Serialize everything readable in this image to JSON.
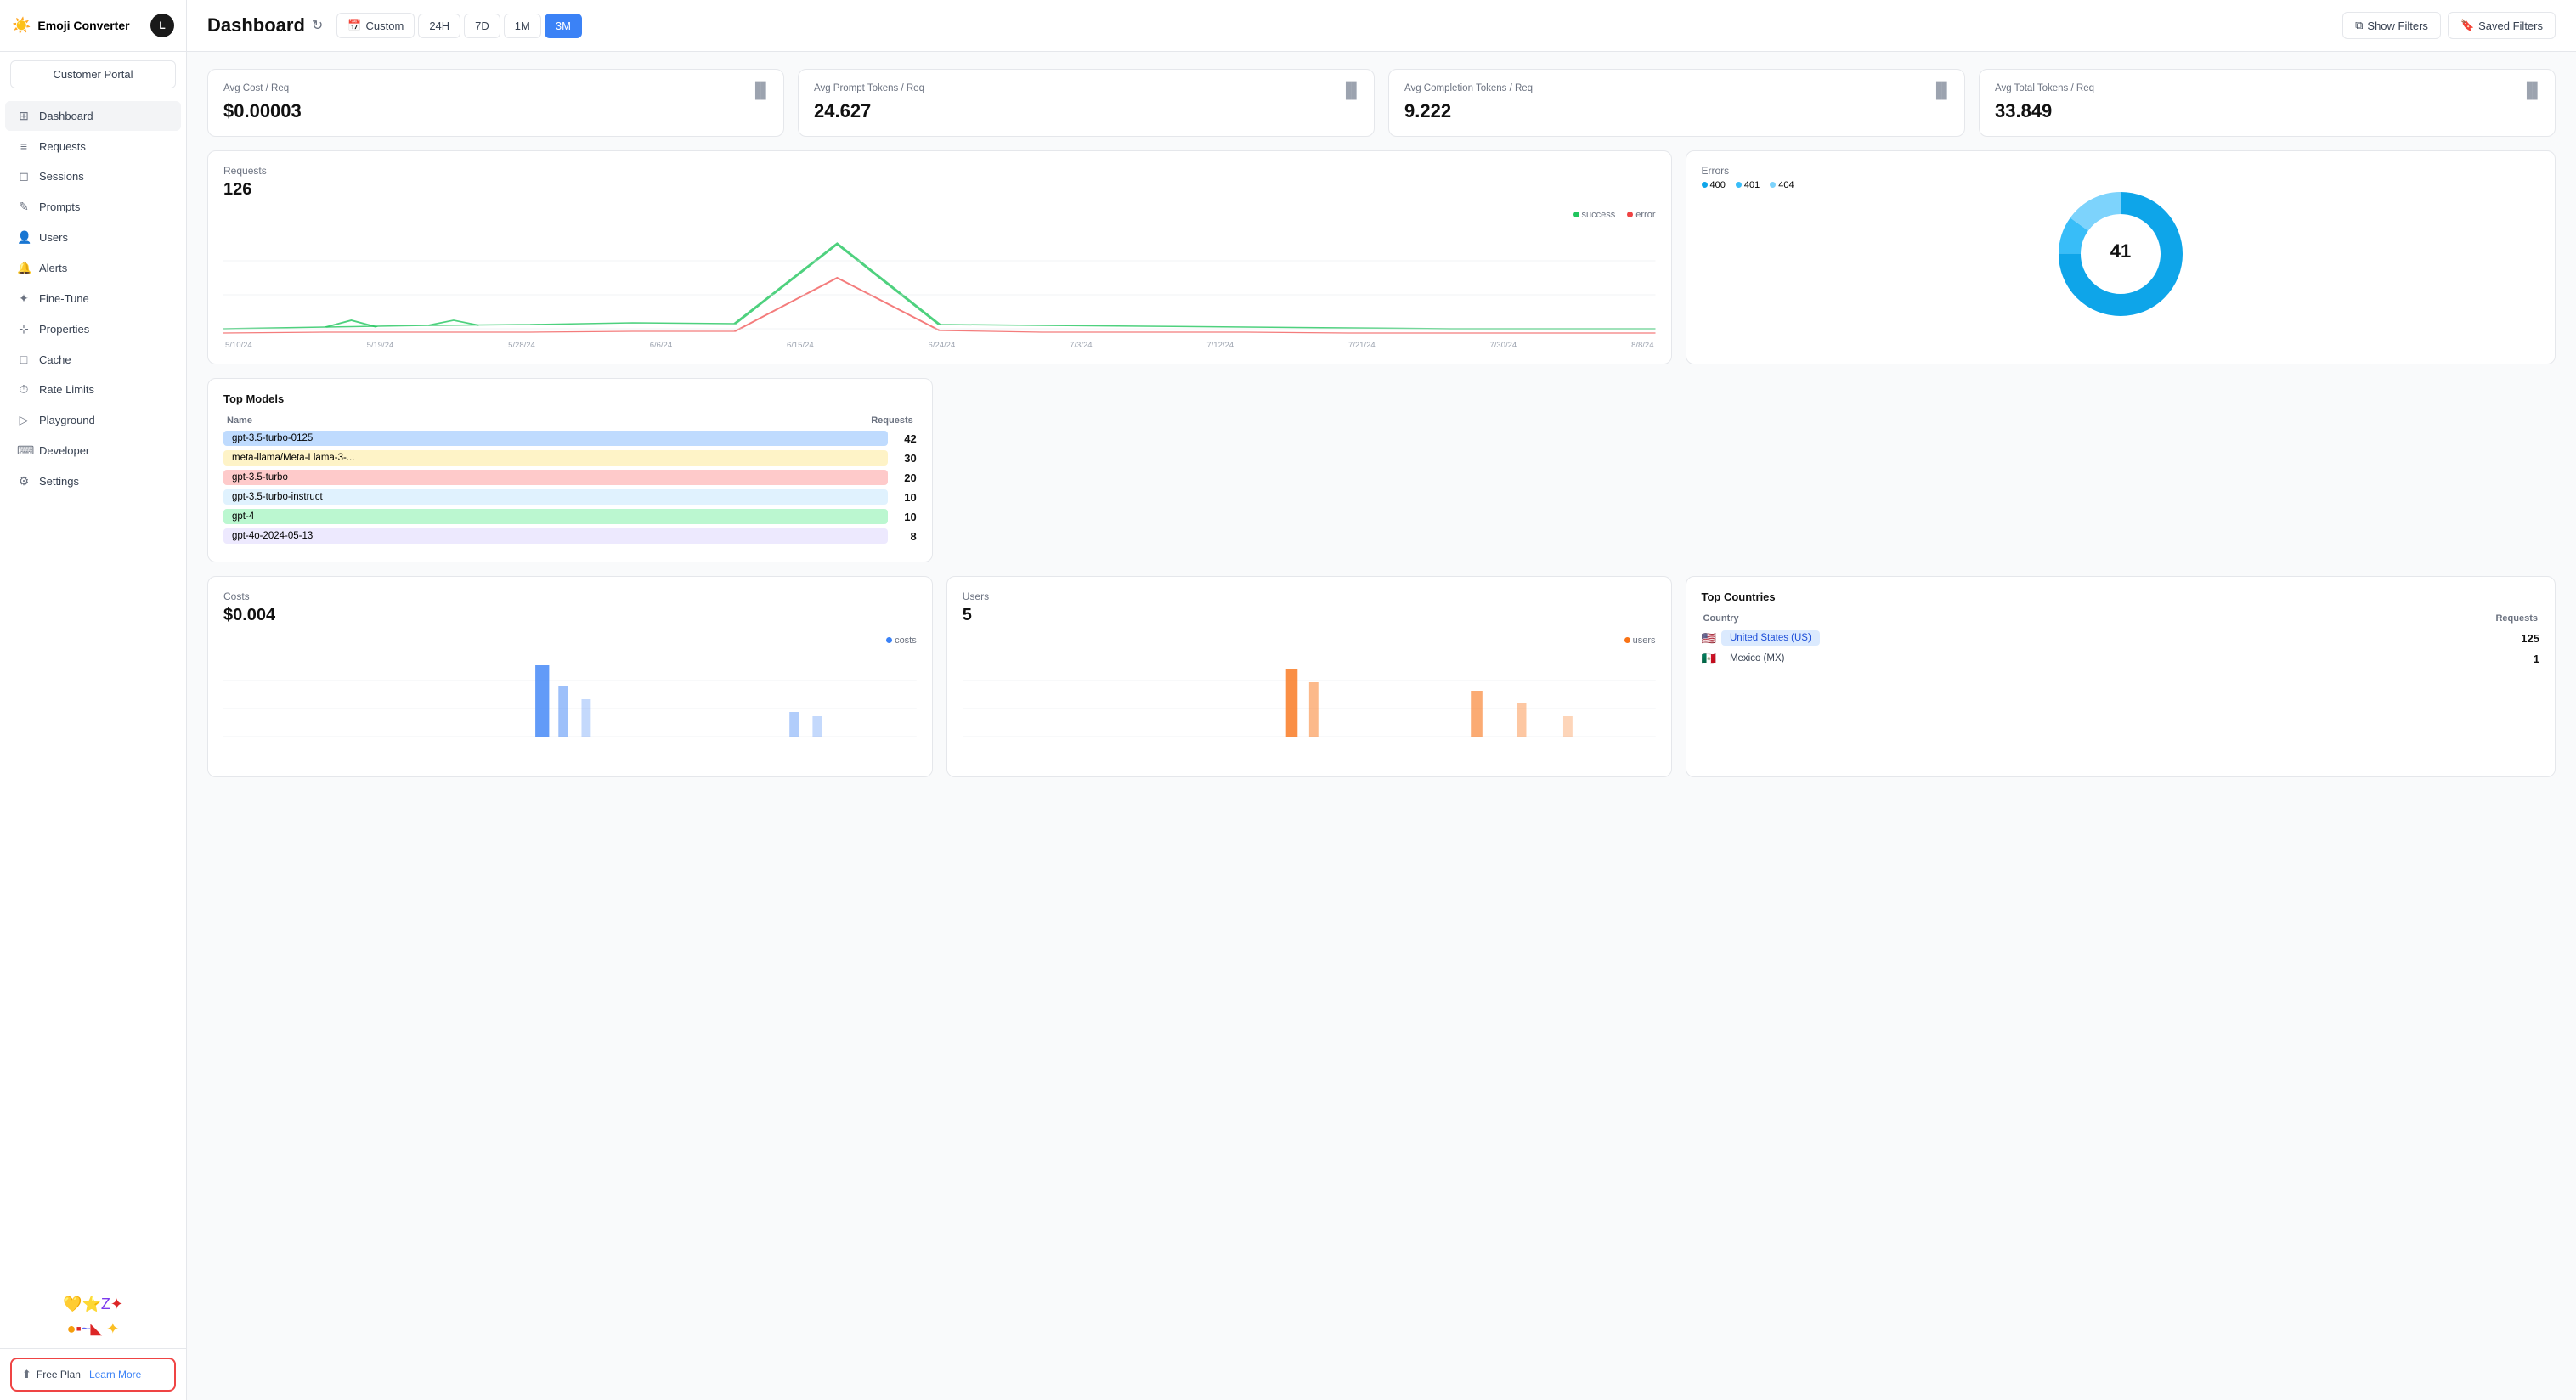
{
  "app": {
    "name": "Emoji Converter",
    "avatar_letter": "L",
    "app_icon": "☀️"
  },
  "sidebar": {
    "customer_portal_label": "Customer Portal",
    "nav_items": [
      {
        "id": "dashboard",
        "label": "Dashboard",
        "icon": "⊞",
        "active": true
      },
      {
        "id": "requests",
        "label": "Requests",
        "icon": "≡"
      },
      {
        "id": "sessions",
        "label": "Sessions",
        "icon": "◻"
      },
      {
        "id": "prompts",
        "label": "Prompts",
        "icon": "✎"
      },
      {
        "id": "users",
        "label": "Users",
        "icon": "👤"
      },
      {
        "id": "alerts",
        "label": "Alerts",
        "icon": "🔔"
      },
      {
        "id": "finetune",
        "label": "Fine-Tune",
        "icon": "✦"
      },
      {
        "id": "properties",
        "label": "Properties",
        "icon": "⊹"
      },
      {
        "id": "cache",
        "label": "Cache",
        "icon": "□"
      },
      {
        "id": "ratelimits",
        "label": "Rate Limits",
        "icon": "⏱"
      },
      {
        "id": "playground",
        "label": "Playground",
        "icon": "▷"
      },
      {
        "id": "developer",
        "label": "Developer",
        "icon": "⌨"
      },
      {
        "id": "settings",
        "label": "Settings",
        "icon": "⚙"
      }
    ],
    "free_plan": "Free Plan",
    "learn_more": "Learn More"
  },
  "header": {
    "title": "Dashboard",
    "time_filters": [
      "Custom",
      "24H",
      "7D",
      "1M",
      "3M"
    ],
    "active_filter": "3M",
    "show_filters": "Show Filters",
    "saved_filters": "Saved Filters"
  },
  "stats": [
    {
      "label": "Avg Cost / Req",
      "value": "$0.00003"
    },
    {
      "label": "Avg Prompt Tokens / Req",
      "value": "24.627"
    },
    {
      "label": "Avg Completion Tokens / Req",
      "value": "9.222"
    },
    {
      "label": "Avg Total Tokens / Req",
      "value": "33.849"
    }
  ],
  "requests_chart": {
    "title": "Requests",
    "value": "126",
    "legend_success": "success",
    "legend_error": "error",
    "x_labels": [
      "5/10/24",
      "5/19/24",
      "5/28/24",
      "6/6/24",
      "6/15/24",
      "6/24/24",
      "7/3/24",
      "7/12/24",
      "7/21/24",
      "7/30/24",
      "8/8/24"
    ]
  },
  "errors_chart": {
    "title": "Errors",
    "center_value": "41",
    "legend": [
      {
        "label": "400",
        "color": "#0ea5e9"
      },
      {
        "label": "401",
        "color": "#38bdf8"
      },
      {
        "label": "404",
        "color": "#7dd3fc"
      }
    ]
  },
  "top_models": {
    "title": "Top Models",
    "col_name": "Name",
    "col_requests": "Requests",
    "rows": [
      {
        "name": "gpt-3.5-turbo-0125",
        "count": 42,
        "color": "#bfdbfe"
      },
      {
        "name": "meta-llama/Meta-Llama-3-...",
        "count": 30,
        "color": "#fef3c7"
      },
      {
        "name": "gpt-3.5-turbo",
        "count": 20,
        "color": "#fecaca"
      },
      {
        "name": "gpt-3.5-turbo-instruct",
        "count": 10,
        "color": "#e0f2fe"
      },
      {
        "name": "gpt-4",
        "count": 10,
        "color": "#bbf7d0"
      },
      {
        "name": "gpt-4o-2024-05-13",
        "count": 8,
        "color": "#ede9fe"
      }
    ]
  },
  "costs_chart": {
    "title": "Costs",
    "value": "$0.004",
    "legend": "costs"
  },
  "users_chart": {
    "title": "Users",
    "value": "5",
    "legend": "users"
  },
  "top_countries": {
    "title": "Top Countries",
    "col_country": "Country",
    "col_requests": "Requests",
    "rows": [
      {
        "flag": "🇺🇸",
        "name": "United States (US)",
        "count": 125,
        "highlight": true
      },
      {
        "flag": "🇲🇽",
        "name": "Mexico (MX)",
        "count": 1,
        "highlight": false
      }
    ]
  }
}
